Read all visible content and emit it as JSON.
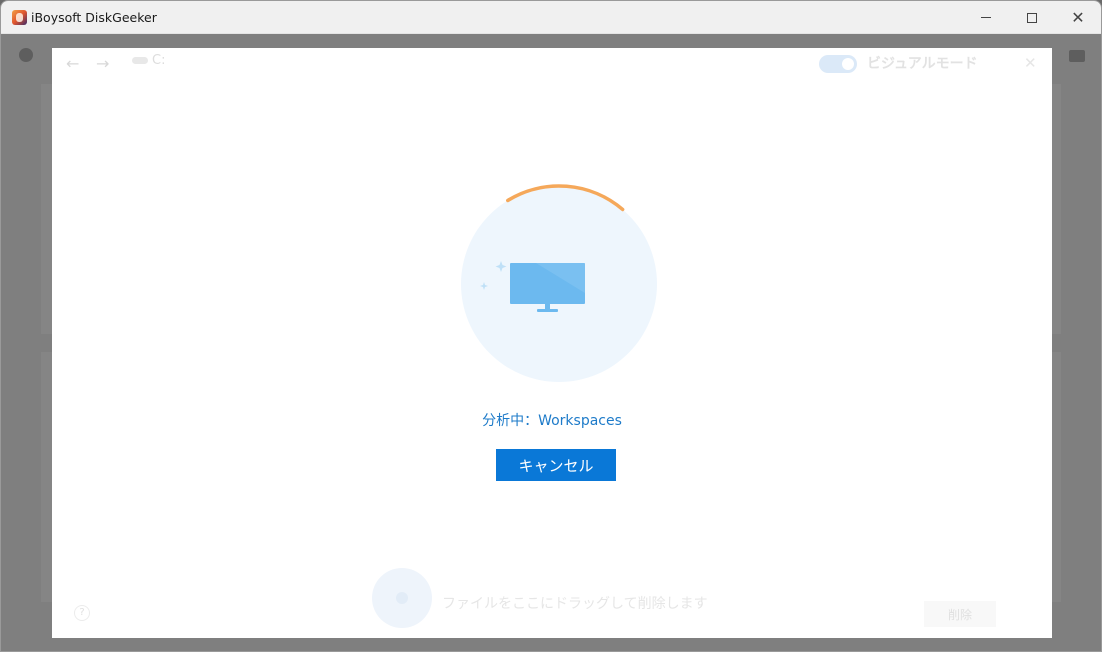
{
  "window": {
    "title": "iBoysoft DiskGeeker",
    "minimize_symbol": "—",
    "maximize_symbol": "□",
    "close_symbol": "✕"
  },
  "modal": {
    "nav": {
      "back_symbol": "←",
      "forward_symbol": "→",
      "path": "C:"
    },
    "visual_mode": {
      "label": "ビジュアルモード",
      "enabled": true
    },
    "close_symbol": "✕",
    "scan": {
      "status_label": "分析中：",
      "target": "Workspaces",
      "progress_fraction": 0.2,
      "cancel_label": "キャンセル"
    },
    "bottom": {
      "help_symbol": "?",
      "drop_text": "ファイルをここにドラッグして削除します",
      "delete_label": "削除"
    }
  },
  "colors": {
    "accent": "#0a78d7",
    "progress_arc": "#f5a85a",
    "monitor": "#6cb9ef",
    "circle_bg": "#eef6fd"
  }
}
